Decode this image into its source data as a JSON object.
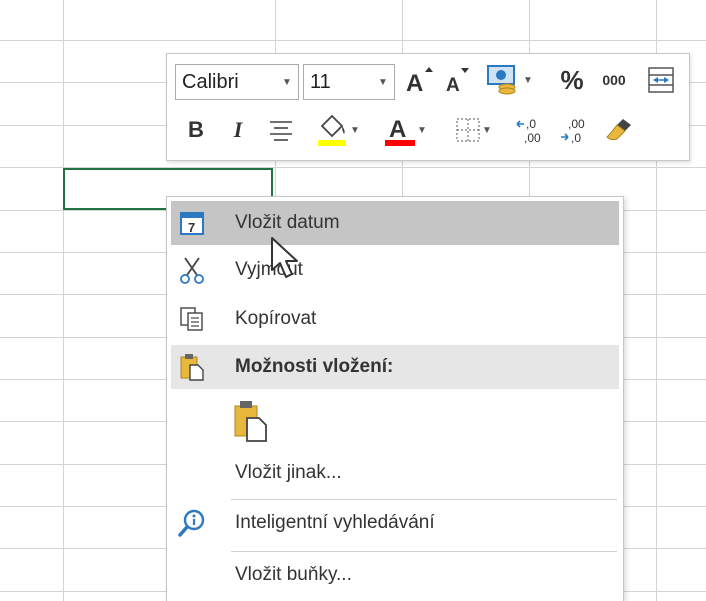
{
  "mini_toolbar": {
    "font_name": "Calibri",
    "font_size": "11",
    "percent_label": "%",
    "thousands_label": "000",
    "bold_label": "B",
    "italic_label": "I",
    "fill_color": "#ffff00",
    "font_color": "#ff0000"
  },
  "context_menu": {
    "items": [
      {
        "label": "Vložit datum",
        "icon": "calendar-icon",
        "state": "hover"
      },
      {
        "label": "Vyjmout",
        "icon": "scissors-icon"
      },
      {
        "label": "Kopírovat",
        "icon": "copy-icon"
      },
      {
        "label": "Možnosti vložení:",
        "icon": "paste-icon",
        "state": "header"
      },
      {
        "label": "",
        "icon": "paste-option-icon"
      },
      {
        "label": "Vložit jinak...",
        "icon": ""
      },
      {
        "label": "Inteligentní vyhledávání",
        "icon": "smart-lookup-icon"
      },
      {
        "label": "Vložit buňky...",
        "icon": ""
      }
    ]
  },
  "colors": {
    "selection_border": "#217346",
    "menu_hover": "#c5c5c5",
    "menu_header": "#e6e6e6",
    "gridline": "#d4d4d4"
  }
}
